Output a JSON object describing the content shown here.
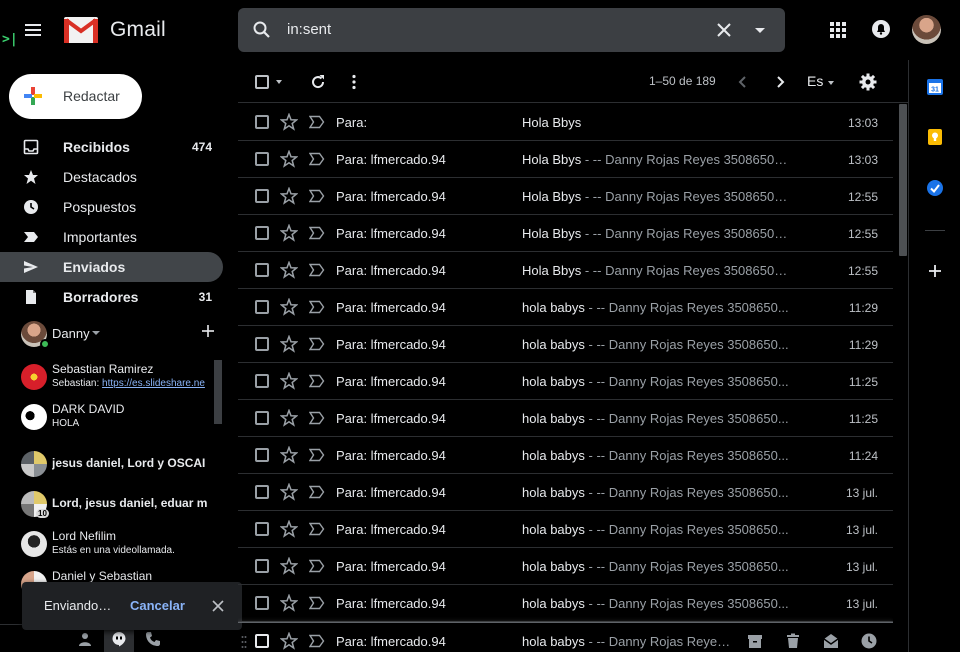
{
  "header": {
    "app_name": "Gmail",
    "terminal_glyph": ">|",
    "search_value": "in:sent"
  },
  "sidebar": {
    "compose_label": "Redactar",
    "items": [
      {
        "label": "Recibidos",
        "count": "474",
        "icon": "inbox-icon",
        "bold": true
      },
      {
        "label": "Destacados",
        "count": "",
        "icon": "star-icon",
        "bold": false
      },
      {
        "label": "Pospuestos",
        "count": "",
        "icon": "clock-icon",
        "bold": false
      },
      {
        "label": "Importantes",
        "count": "",
        "icon": "important-icon",
        "bold": false
      },
      {
        "label": "Enviados",
        "count": "",
        "icon": "send-icon",
        "bold": true,
        "active": true
      },
      {
        "label": "Borradores",
        "count": "31",
        "icon": "draft-icon",
        "bold": true
      }
    ],
    "hangouts_user": "Danny",
    "chats": [
      {
        "name": "Sebastian Ramirez",
        "sub_prefix": "Sebastian: ",
        "sub_link": "https://es.slideshare.ne"
      },
      {
        "name": "DARK DAVID",
        "sub_prefix": "HOLA",
        "sub_link": ""
      },
      {
        "name": "jesus daniel, Lord y OSCAI",
        "sub_prefix": "",
        "sub_link": ""
      },
      {
        "name": "Lord, jesus daniel, eduar m",
        "sub_prefix": "",
        "sub_link": ""
      },
      {
        "name": "Lord Nefilim",
        "sub_prefix": "Estás en una videollamada.",
        "sub_link": ""
      },
      {
        "name": "Daniel y Sebastian",
        "sub_prefix": "",
        "sub_link": ""
      }
    ],
    "group_badge": "10"
  },
  "snackbar": {
    "text": "Enviando…",
    "action": "Cancelar"
  },
  "toolbar": {
    "pager": "1–50 de 189",
    "lang": "Es"
  },
  "emails": [
    {
      "to": "Para:",
      "subject": "Hola Bbys",
      "snippet": "",
      "date": "13:03"
    },
    {
      "to": "Para: lfmercado.94",
      "subject": "Hola Bbys",
      "snippet": " - -- Danny Rojas Reyes 35086500...",
      "date": "13:03"
    },
    {
      "to": "Para: lfmercado.94",
      "subject": "Hola Bbys",
      "snippet": " - -- Danny Rojas Reyes 35086500...",
      "date": "12:55"
    },
    {
      "to": "Para: lfmercado.94",
      "subject": "Hola Bbys",
      "snippet": " - -- Danny Rojas Reyes 35086500...",
      "date": "12:55"
    },
    {
      "to": "Para: lfmercado.94",
      "subject": "Hola Bbys",
      "snippet": " - -- Danny Rojas Reyes 35086500...",
      "date": "12:55"
    },
    {
      "to": "Para: lfmercado.94",
      "subject": "hola babys",
      "snippet": " - -- Danny Rojas Reyes 3508650...",
      "date": "11:29"
    },
    {
      "to": "Para: lfmercado.94",
      "subject": "hola babys",
      "snippet": " - -- Danny Rojas Reyes 3508650...",
      "date": "11:29"
    },
    {
      "to": "Para: lfmercado.94",
      "subject": "hola babys",
      "snippet": " - -- Danny Rojas Reyes 3508650...",
      "date": "11:25"
    },
    {
      "to": "Para: lfmercado.94",
      "subject": "hola babys",
      "snippet": " - -- Danny Rojas Reyes 3508650...",
      "date": "11:25"
    },
    {
      "to": "Para: lfmercado.94",
      "subject": "hola babys",
      "snippet": " - -- Danny Rojas Reyes 3508650...",
      "date": "11:24"
    },
    {
      "to": "Para: lfmercado.94",
      "subject": "hola babys",
      "snippet": " - -- Danny Rojas Reyes 3508650...",
      "date": "13 jul."
    },
    {
      "to": "Para: lfmercado.94",
      "subject": "hola babys",
      "snippet": " - -- Danny Rojas Reyes 3508650...",
      "date": "13 jul."
    },
    {
      "to": "Para: lfmercado.94",
      "subject": "hola babys",
      "snippet": " - -- Danny Rojas Reyes 3508650...",
      "date": "13 jul."
    },
    {
      "to": "Para: lfmercado.94",
      "subject": "hola babys",
      "snippet": " - -- Danny Rojas Reyes 3508650...",
      "date": "13 jul."
    },
    {
      "to": "Para: lfmercado.94",
      "subject": "hola babys",
      "snippet": " - -- Danny Rojas Reyes...",
      "date": "",
      "hovered": true
    }
  ],
  "sidepanel": {
    "calendar_day": "31"
  },
  "colors": {
    "background": "#000000",
    "search_bg": "#3c3f43",
    "active_nav": "#414549",
    "link": "#8ab4f8",
    "online": "#3dbb57"
  }
}
